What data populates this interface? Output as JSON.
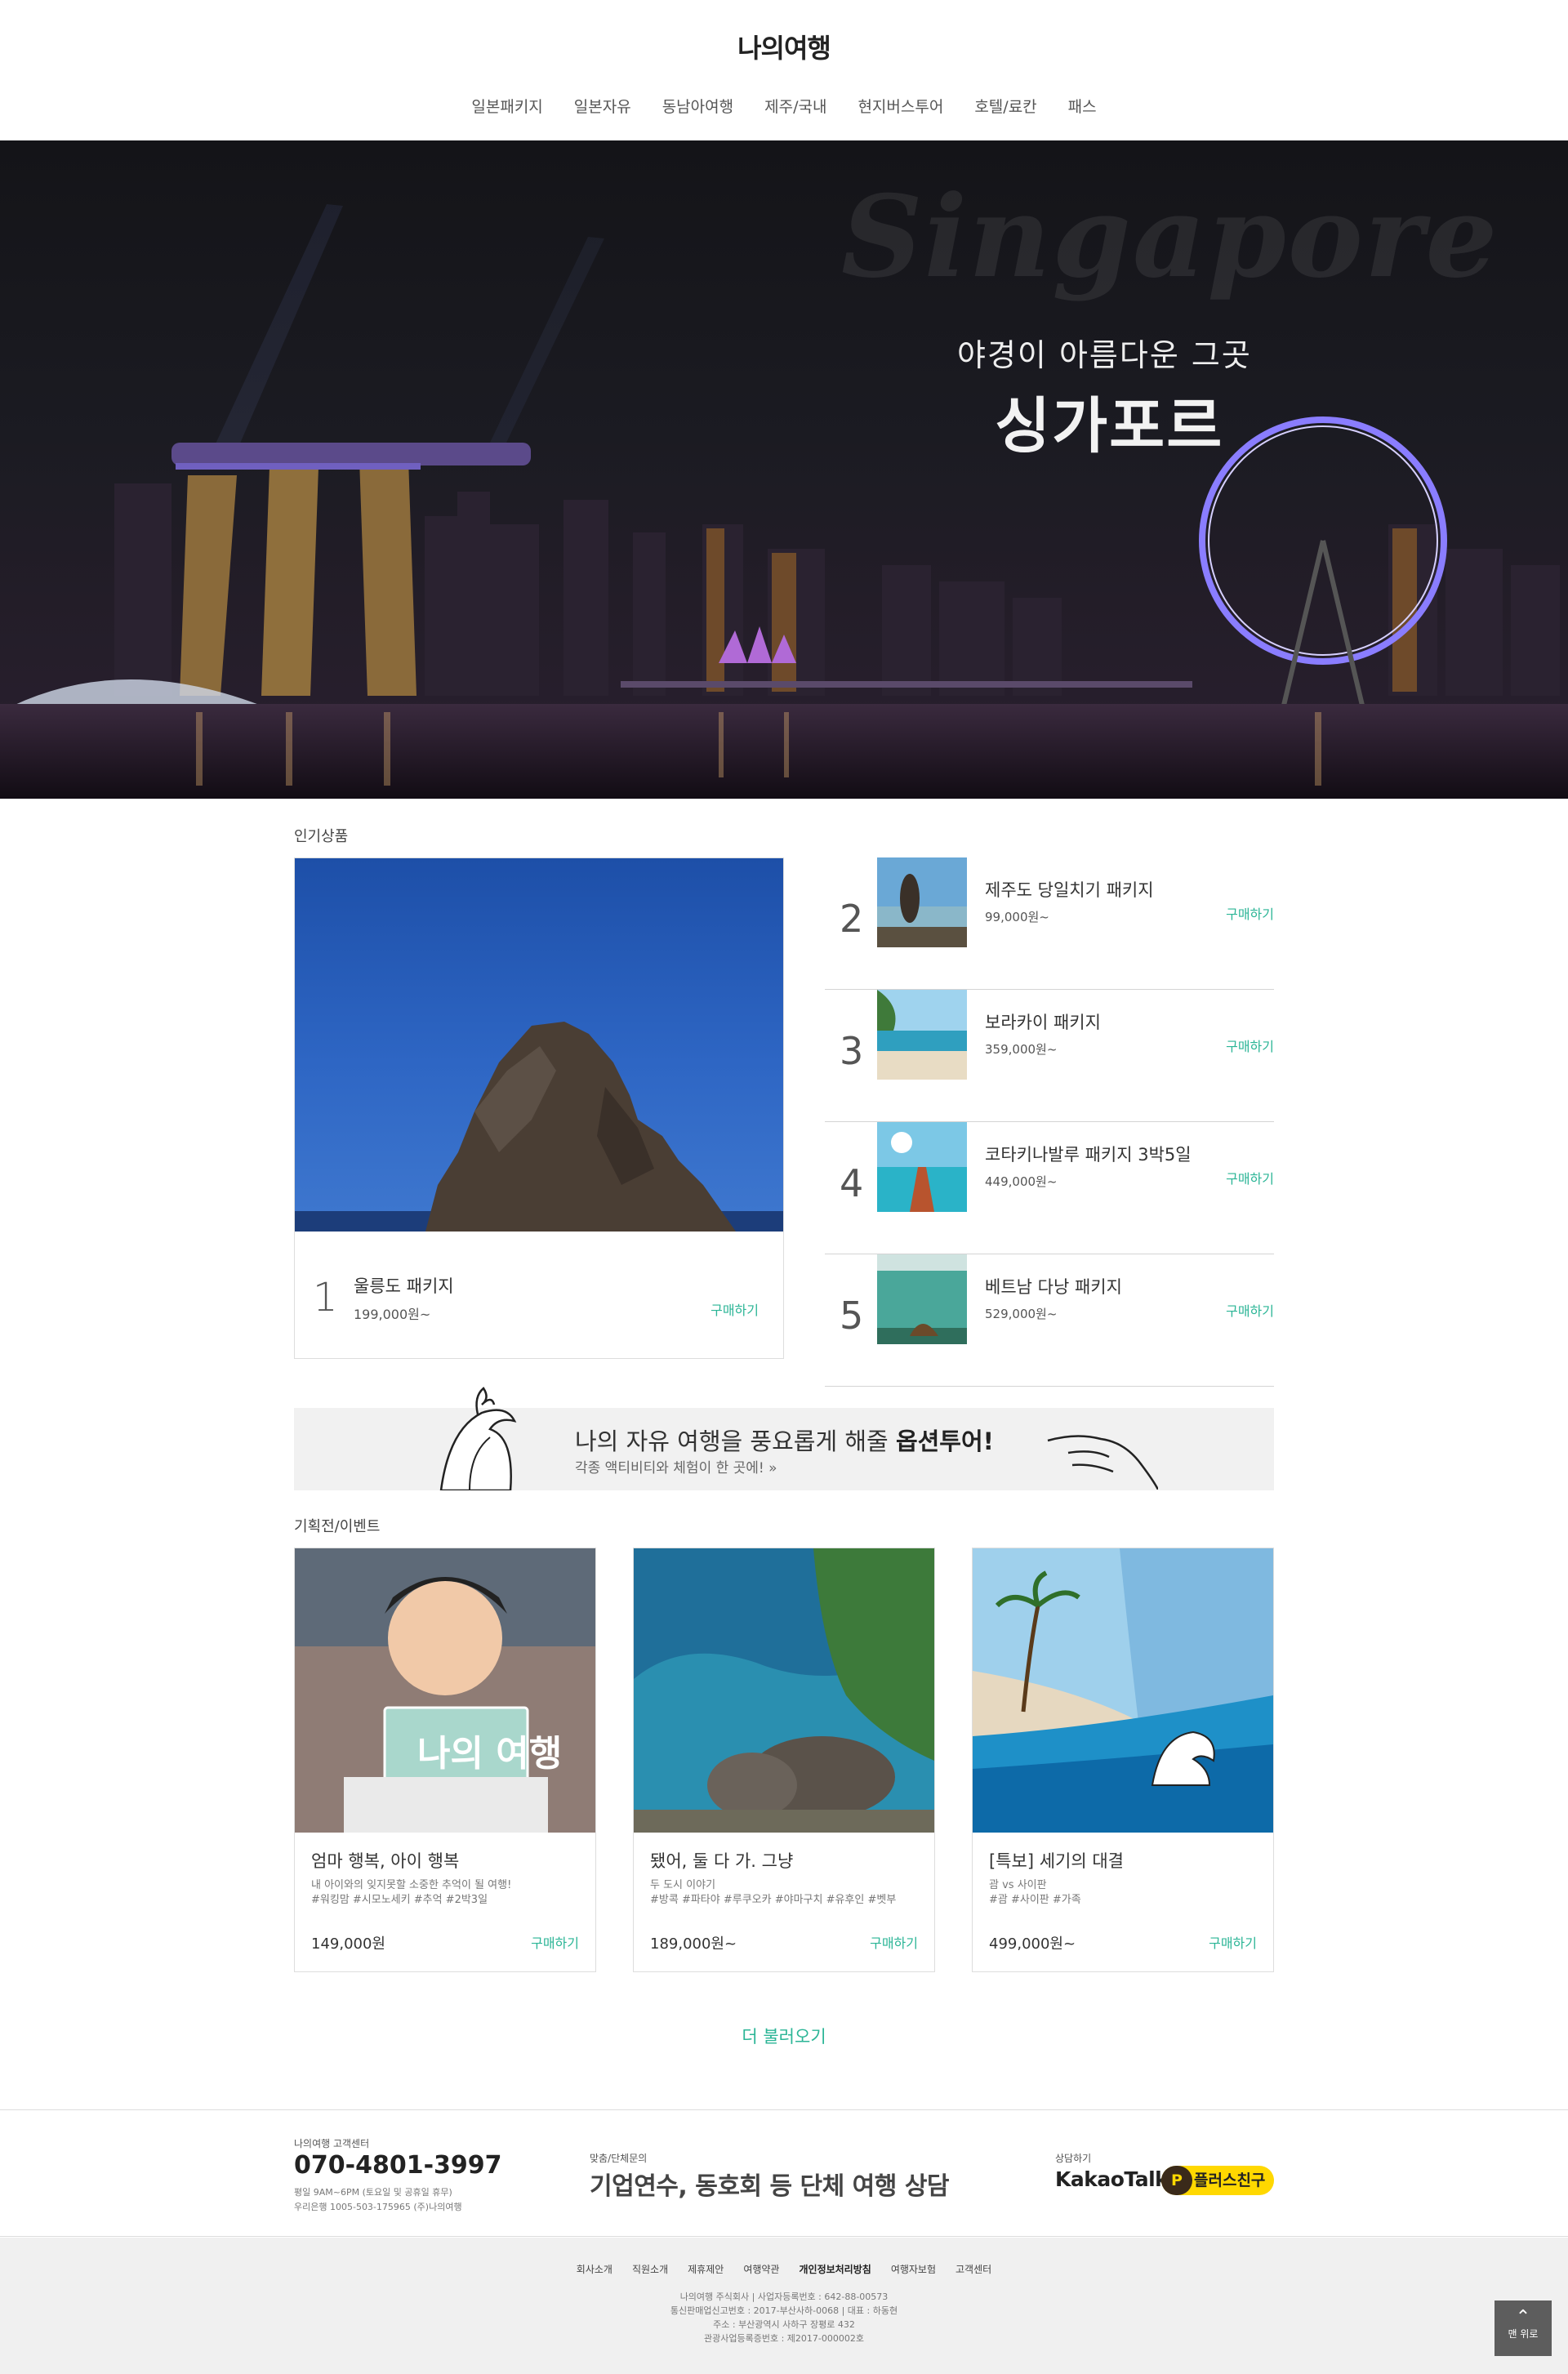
{
  "header": {
    "logo": "나의여행",
    "nav": [
      "일본패키지",
      "일본자유",
      "동남아여행",
      "제주/국내",
      "현지버스투어",
      "호텔/료칸",
      "패스"
    ]
  },
  "hero": {
    "script": "Singapore",
    "subtitle": "야경이 아름다운 그곳",
    "title": "싱가포르"
  },
  "popular": {
    "title": "인기상품",
    "main": {
      "rank": "1",
      "name": "울릉도 패키지",
      "price": "199,000원~",
      "buy": "구매하기"
    },
    "items": [
      {
        "rank": "2",
        "name": "제주도 당일치기 패키지",
        "price": "99,000원~",
        "buy": "구매하기"
      },
      {
        "rank": "3",
        "name": "보라카이 패키지",
        "price": "359,000원~",
        "buy": "구매하기"
      },
      {
        "rank": "4",
        "name": "코타키나발루 패키지 3박5일",
        "price": "449,000원~",
        "buy": "구매하기"
      },
      {
        "rank": "5",
        "name": "베트남 다낭 패키지",
        "price": "529,000원~",
        "buy": "구매하기"
      }
    ]
  },
  "banner": {
    "title_prefix": "나의 자유 여행을 풍요롭게 해줄 ",
    "title_bold": "옵션투어!",
    "subtitle": "각종 액티비티와 체험이 한 곳에!"
  },
  "events": {
    "title": "기획전/이벤트",
    "cards": [
      {
        "name": "엄마 행복, 아이 행복",
        "desc1": "내 아이와의 잊지못할 소중한 추억이 될 여행!",
        "desc2": "#워킹맘 #시모노세키 #추억 #2박3일",
        "price": "149,000원",
        "buy": "구매하기",
        "sign": "나의 여행"
      },
      {
        "name": "됐어, 둘 다 가. 그냥",
        "desc1": "두 도시 이야기",
        "desc2": "#방콕 #파타야 #루쿠오카 #야마구치 #유후인 #벳부",
        "price": "189,000원~",
        "buy": "구매하기"
      },
      {
        "name": "[특보] 세기의 대결",
        "desc1": "괌 vs 사이판",
        "desc2": "#괌 #사이판 #가족",
        "price": "499,000원~",
        "buy": "구매하기"
      }
    ]
  },
  "more": "더 불러오기",
  "cs": {
    "label": "나의여행 고객센터",
    "phone": "070-4801-3997",
    "hours": "평일 9AM~6PM (토요일 및 공휴일 휴무)",
    "bank": "우리은행 1005-503-175965 (주)나의여행",
    "group_label": "맞춤/단체문의",
    "group_title": "기업연수, 동호회 등 단체 여행 상담",
    "consult_label": "상담하기",
    "kakao": "KakaoTalk",
    "plus_icon": "P",
    "plus": "플러스친구"
  },
  "footer": {
    "links": [
      "회사소개",
      "직원소개",
      "제휴제안",
      "여행약관",
      "개인정보처리방침",
      "여행자보험",
      "고객센터"
    ],
    "info": [
      "나의여행 주식회사 | 사업자등록번호 : 642-88-00573",
      "통신판매업신고번호 : 2017-부산사하-0068 | 대표 : 하동현",
      "주소 : 부산광역시 사하구 장평로 432",
      "관광사업등록증번호 : 제2017-000002호"
    ],
    "top_button": "맨 위로"
  },
  "colors": {
    "accent": "#2bb596",
    "kakao_yellow": "#ffd800",
    "footer_bg": "#f0f0f0"
  }
}
